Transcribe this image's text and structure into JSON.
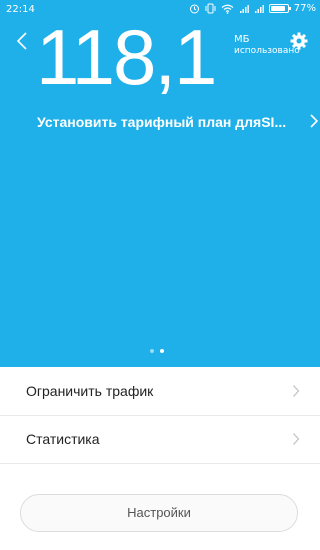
{
  "status_bar": {
    "time": "22:14",
    "battery": "77%",
    "battery_level": 0.77,
    "icons": [
      "alarm-icon",
      "vibrate-icon",
      "wifi-icon",
      "signal-icon",
      "signal-icon",
      "battery-icon"
    ]
  },
  "usage": {
    "amount": "118,1",
    "unit": "МБ",
    "label": "использовано"
  },
  "plan_prompt": "Установить тарифный план дляSI...",
  "pager": {
    "pages": 2,
    "active": 1
  },
  "menu": [
    {
      "label": "Ограничить трафик"
    },
    {
      "label": "Статистика"
    }
  ],
  "settings_button": "Настройки",
  "colors": {
    "accent": "#1fb0ea",
    "text": "#222222"
  }
}
